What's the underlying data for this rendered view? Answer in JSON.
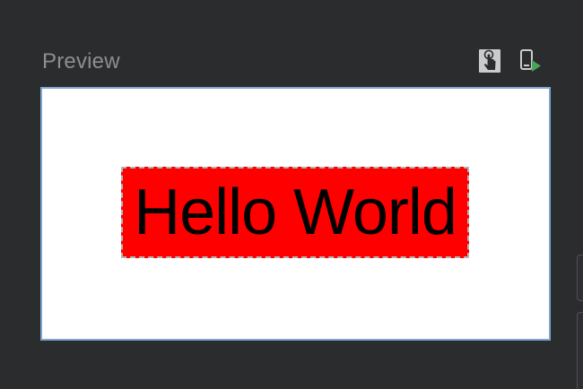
{
  "header": {
    "title": "Preview",
    "actions": [
      {
        "name": "interactive-mode",
        "icon": "hand-pointer-icon"
      },
      {
        "name": "deploy-preview",
        "icon": "phone-run-icon",
        "accent": "#4aa35a"
      }
    ]
  },
  "preview": {
    "text": "Hello World",
    "text_color": "#000000",
    "background_color": "#ff0000",
    "canvas_color": "#ffffff",
    "frame_border_color": "#7fa6d4"
  },
  "colors": {
    "panel_background": "#2b2c2e",
    "title_color": "#8c8e91"
  }
}
